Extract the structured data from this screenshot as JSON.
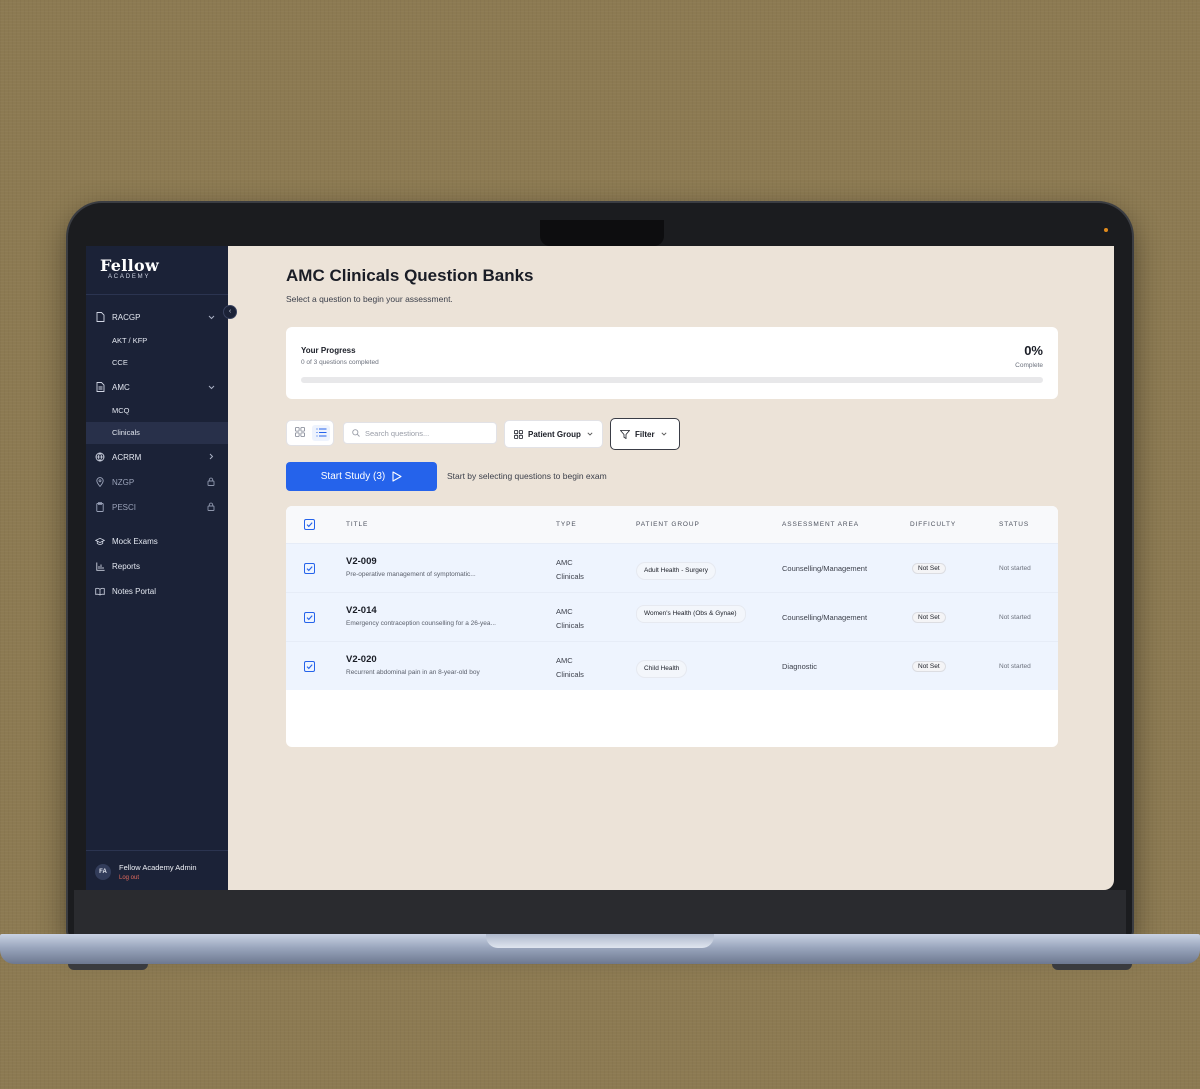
{
  "brand": {
    "name": "Fellow",
    "sub": "ACADEMY"
  },
  "sidebar": {
    "groups": [
      {
        "label": "RACGP",
        "icon": "document-icon",
        "trail": "⌄"
      },
      {
        "label": "AKT / KFP"
      },
      {
        "label": "CCE"
      },
      {
        "label": "AMC",
        "icon": "document-icon",
        "trail": "⌄"
      },
      {
        "label": "MCQ"
      },
      {
        "label": "Clinicals",
        "active": true
      },
      {
        "label": "ACRRM",
        "icon": "globe-icon",
        "trail": "›"
      },
      {
        "label": "NZGP",
        "icon": "location-icon",
        "trail": "lock"
      },
      {
        "label": "PESCI",
        "icon": "clipboard-icon",
        "trail": "lock"
      },
      {
        "label": "Mock Exams",
        "icon": "graduation-cap-icon"
      },
      {
        "label": "Reports",
        "icon": "bar-chart-icon"
      },
      {
        "label": "Notes Portal",
        "icon": "book-icon"
      }
    ],
    "user": {
      "initials": "FA",
      "name": "Fellow Academy Admin",
      "logout": "Log out"
    }
  },
  "header": {
    "title": "AMC Clinicals Question Banks",
    "subtitle": "Select a question to begin your assessment."
  },
  "progress": {
    "title": "Your Progress",
    "subtitle": "0 of 3 questions completed",
    "percent_label": "0%",
    "complete_label": "Complete",
    "fraction": 0
  },
  "toolbar": {
    "search_placeholder": "Search questions...",
    "patient_group_label": "Patient Group",
    "filter_label": "Filter"
  },
  "actions": {
    "start_label": "Start Study (3)",
    "hint": "Start by selecting questions to begin exam"
  },
  "table": {
    "headers": [
      "TITLE",
      "TYPE",
      "PATIENT GROUP",
      "ASSESSMENT AREA",
      "DIFFICULTY",
      "STATUS"
    ],
    "rows": [
      {
        "id": "V2-009",
        "desc": "Pre-operative management of symptomatic...",
        "type_1": "AMC",
        "type_2": "Clinicals",
        "group": "Adult Health - Surgery",
        "area": "Counselling/Management",
        "difficulty": "Not Set",
        "status": "Not started"
      },
      {
        "id": "V2-014",
        "desc": "Emergency contraception counselling for a 26-yea...",
        "type_1": "AMC",
        "type_2": "Clinicals",
        "group": "Women's Health (Obs & Gynae)",
        "area": "Counselling/Management",
        "difficulty": "Not Set",
        "status": "Not started"
      },
      {
        "id": "V2-020",
        "desc": "Recurrent abdominal pain in an 8-year-old boy",
        "type_1": "AMC",
        "type_2": "Clinicals",
        "group": "Child Health",
        "area": "Diagnostic",
        "difficulty": "Not Set",
        "status": "Not started"
      }
    ]
  },
  "colors": {
    "accent": "#2563eb",
    "sidebar": "#1b2237",
    "background": "#ece3d8",
    "logout": "#e36b5e"
  }
}
